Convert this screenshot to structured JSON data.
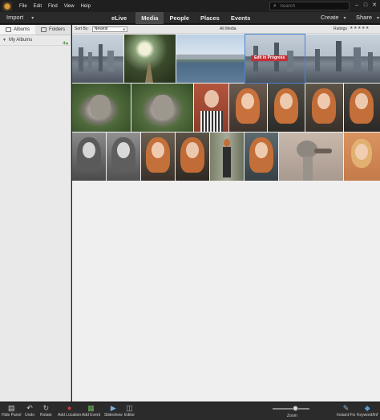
{
  "menubar": {
    "items": [
      "File",
      "Edit",
      "Find",
      "View",
      "Help"
    ],
    "search_placeholder": "Search",
    "window_controls": [
      "–",
      "□",
      "✕"
    ]
  },
  "modebar": {
    "import_label": "Import",
    "tabs": [
      "eLive",
      "Media",
      "People",
      "Places",
      "Events"
    ],
    "active_tab": "Media",
    "create_label": "Create",
    "share_label": "Share"
  },
  "leftpanel": {
    "tabs": [
      "Albums",
      "Folders"
    ],
    "active_tab": "Albums",
    "section_label": "My Albums",
    "add_symbol": "+"
  },
  "toolbar": {
    "sort_label": "Sort By:",
    "sort_value": "Newest",
    "view_label": "All Media",
    "ratings_label": "Ratings",
    "stars": "★★★★★"
  },
  "media": {
    "badge_text": "Edit in Progress",
    "selected_thumb": "row1-4",
    "rows": [
      [
        {
          "id": "row1-1",
          "subject": "city-skyline"
        },
        {
          "id": "row1-2",
          "subject": "forest-path"
        },
        {
          "id": "row1-3",
          "subject": "river-harbour"
        },
        {
          "id": "row1-4",
          "subject": "city-skyline-edit"
        },
        {
          "id": "row1-5",
          "subject": "city-skyline"
        }
      ],
      [
        {
          "id": "row2-1",
          "subject": "squirrel"
        },
        {
          "id": "row2-2",
          "subject": "squirrel"
        },
        {
          "id": "row2-3",
          "subject": "portrait"
        },
        {
          "id": "row2-4",
          "subject": "portrait"
        },
        {
          "id": "row2-5",
          "subject": "portrait"
        },
        {
          "id": "row2-6",
          "subject": "portrait"
        },
        {
          "id": "row2-7",
          "subject": "portrait"
        }
      ],
      [
        {
          "id": "row3-1",
          "subject": "portrait-bw"
        },
        {
          "id": "row3-2",
          "subject": "portrait-bw"
        },
        {
          "id": "row3-3",
          "subject": "portrait"
        },
        {
          "id": "row3-4",
          "subject": "portrait"
        },
        {
          "id": "row3-5",
          "subject": "full-body"
        },
        {
          "id": "row3-6",
          "subject": "portrait"
        },
        {
          "id": "row3-7",
          "subject": "ostrich"
        },
        {
          "id": "row3-8",
          "subject": "girl-portrait"
        }
      ]
    ]
  },
  "bottombar": {
    "items": [
      {
        "label": "Hide Panel",
        "icon": "hide-panel-icon",
        "glyph": "▤"
      },
      {
        "label": "Undo",
        "icon": "undo-icon",
        "glyph": "↶"
      },
      {
        "label": "Rotate",
        "icon": "rotate-icon",
        "glyph": "↻"
      },
      {
        "label": "Add Location",
        "icon": "add-location-icon",
        "glyph": "●"
      },
      {
        "label": "Add Event",
        "icon": "add-event-icon",
        "glyph": "▦"
      },
      {
        "label": "Slideshow",
        "icon": "slideshow-icon",
        "glyph": "▶"
      },
      {
        "label": "Editor",
        "icon": "editor-icon",
        "glyph": "◫"
      },
      {
        "label": "Instant Fix",
        "icon": "instant-fix-icon",
        "glyph": "✎"
      },
      {
        "label": "Keyword/Inf",
        "icon": "keyword-icon",
        "glyph": "◆"
      }
    ],
    "zoom_label": "Zoom"
  },
  "colors": {
    "accent_blue": "#4b84d4",
    "badge_red": "#c62f36",
    "add_green": "#3d9a2e"
  }
}
